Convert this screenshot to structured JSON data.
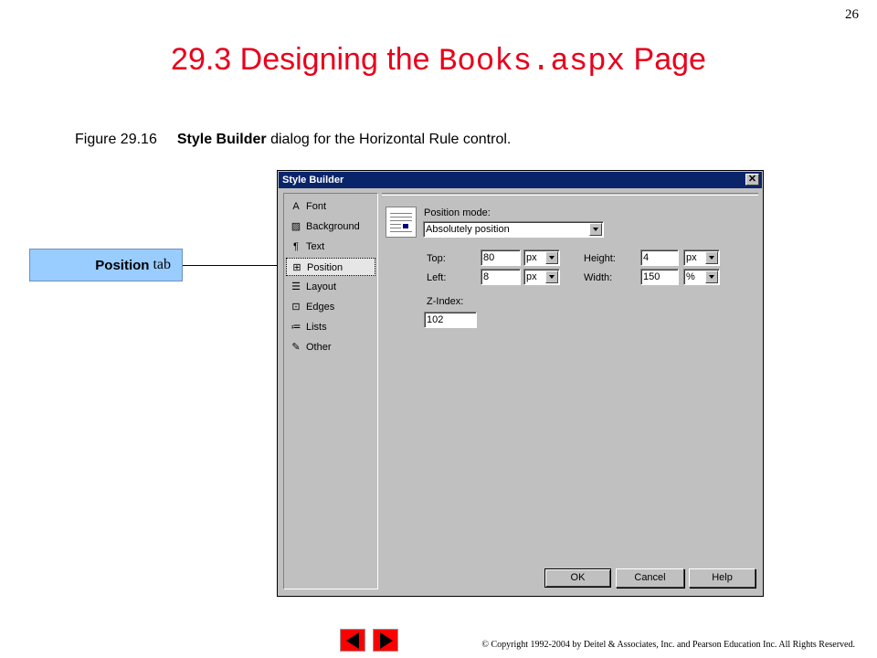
{
  "slide": {
    "number": "26",
    "title_prefix": "29.3  Designing the ",
    "title_code": "Books.aspx",
    "title_suffix": " Page",
    "caption_number": "Figure 29.16",
    "caption_bold": "Style Builder",
    "caption_rest": " dialog for the Horizontal Rule control.",
    "callout_bold": "Position",
    "callout_rest": "tab",
    "copyright": "© Copyright 1992-2004 by Deitel & Associates, Inc. and Pearson Education Inc. All Rights Reserved."
  },
  "dialog": {
    "title": "Style Builder",
    "close_label": "✕",
    "sidebar": [
      {
        "label": "Font",
        "icon": "font-icon",
        "glyph": "A"
      },
      {
        "label": "Background",
        "icon": "background-icon",
        "glyph": "▨"
      },
      {
        "label": "Text",
        "icon": "text-icon",
        "glyph": "¶"
      },
      {
        "label": "Position",
        "icon": "position-icon",
        "glyph": "⊞"
      },
      {
        "label": "Layout",
        "icon": "layout-icon",
        "glyph": "☰"
      },
      {
        "label": "Edges",
        "icon": "edges-icon",
        "glyph": "⊡"
      },
      {
        "label": "Lists",
        "icon": "lists-icon",
        "glyph": "≔"
      },
      {
        "label": "Other",
        "icon": "other-icon",
        "glyph": "✎"
      }
    ],
    "active_tab": "Position",
    "position_mode_label": "Position mode:",
    "position_mode_value": "Absolutely position",
    "top_label": "Top:",
    "top_value": "80",
    "top_unit": "px",
    "left_label": "Left:",
    "left_value": "8",
    "left_unit": "px",
    "height_label": "Height:",
    "height_value": "4",
    "height_unit": "px",
    "width_label": "Width:",
    "width_value": "150",
    "width_unit": "%",
    "zindex_label": "Z-Index:",
    "zindex_value": "102",
    "ok_label": "OK",
    "cancel_label": "Cancel",
    "help_label": "Help"
  },
  "colors": {
    "title": "#e8001c",
    "callout": "#99ccff",
    "titlebar": "#0a246a",
    "nav_buttons": "#ff0000"
  }
}
